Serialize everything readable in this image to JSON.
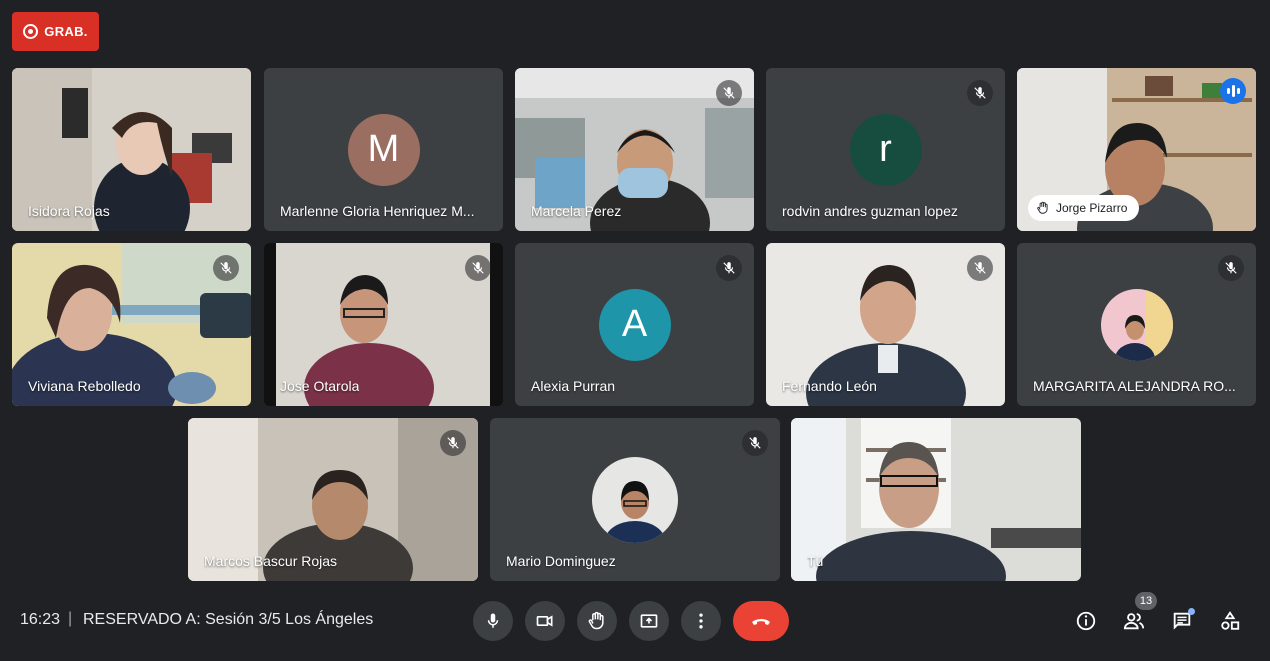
{
  "recording": {
    "label": "GRAB."
  },
  "participants": [
    {
      "name": "Isidora Rojas",
      "muted": false
    },
    {
      "name": "Marlenne Gloria Henriquez M...",
      "muted": false,
      "avatar_letter": "M",
      "avatar_color": "#9a6f62"
    },
    {
      "name": "Marcela Perez",
      "muted": true
    },
    {
      "name": "rodvin andres guzman lopez",
      "muted": true,
      "avatar_letter": "r",
      "avatar_color": "#174d3f"
    },
    {
      "name": "Jorge Pizarro",
      "muted": false,
      "hand_raised": true,
      "speaking": true
    },
    {
      "name": "Viviana Rebolledo",
      "muted": true
    },
    {
      "name": "Jose Otarola",
      "muted": true
    },
    {
      "name": "Alexia Purran",
      "muted": true,
      "avatar_letter": "A",
      "avatar_color": "#1e95a8"
    },
    {
      "name": "Fernando León",
      "muted": true
    },
    {
      "name": "MARGARITA ALEJANDRA RO...",
      "muted": true
    },
    {
      "name": "Marcos Bascur Rojas",
      "muted": true
    },
    {
      "name": "Mario Dominguez",
      "muted": true
    },
    {
      "name": "Tú",
      "muted": false
    }
  ],
  "footer": {
    "time": "16:23",
    "separator": "|",
    "meeting_title": "RESERVADO A: Sesión 3/5 Los Ángeles",
    "participant_count": "13"
  },
  "colors": {
    "background": "#202124",
    "tile": "#3c4043",
    "record": "#d93025",
    "hangup": "#ea4335",
    "active_border": "#669df6"
  }
}
